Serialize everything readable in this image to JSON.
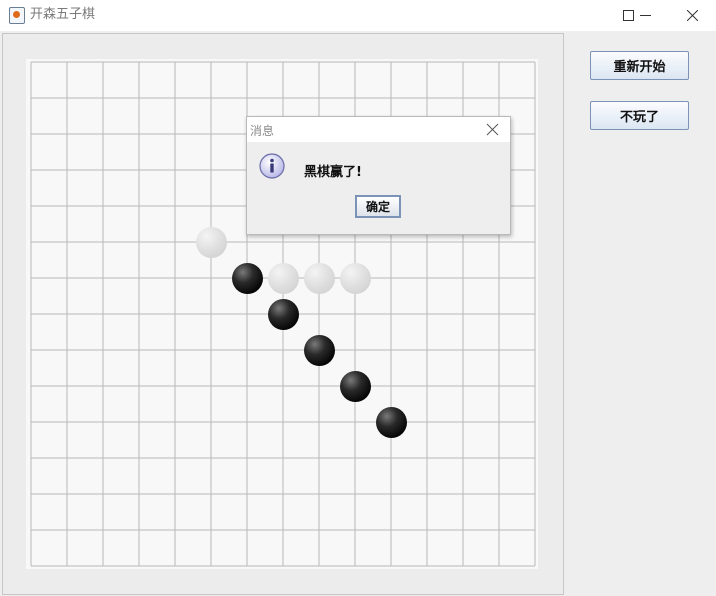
{
  "window": {
    "title": "开森五子棋",
    "controls": [
      "minimize-icon",
      "maximize-icon",
      "close-icon"
    ]
  },
  "board": {
    "size": 14,
    "line_color": "#b8b8b8",
    "background": "#f8f8f8",
    "stones": [
      {
        "color": "white",
        "col": 5,
        "row": 5
      },
      {
        "color": "black",
        "col": 6,
        "row": 6
      },
      {
        "color": "white",
        "col": 7,
        "row": 6
      },
      {
        "color": "white",
        "col": 8,
        "row": 6
      },
      {
        "color": "white",
        "col": 9,
        "row": 6
      },
      {
        "color": "black",
        "col": 7,
        "row": 7
      },
      {
        "color": "black",
        "col": 8,
        "row": 8
      },
      {
        "color": "black",
        "col": 9,
        "row": 9
      },
      {
        "color": "black",
        "col": 10,
        "row": 10
      }
    ]
  },
  "buttons": {
    "restart_label": "重新开始",
    "quit_label": "不玩了"
  },
  "dialog": {
    "title": "消息",
    "icon": "info-icon",
    "message": "黑棋赢了!",
    "ok_label": "确定"
  }
}
